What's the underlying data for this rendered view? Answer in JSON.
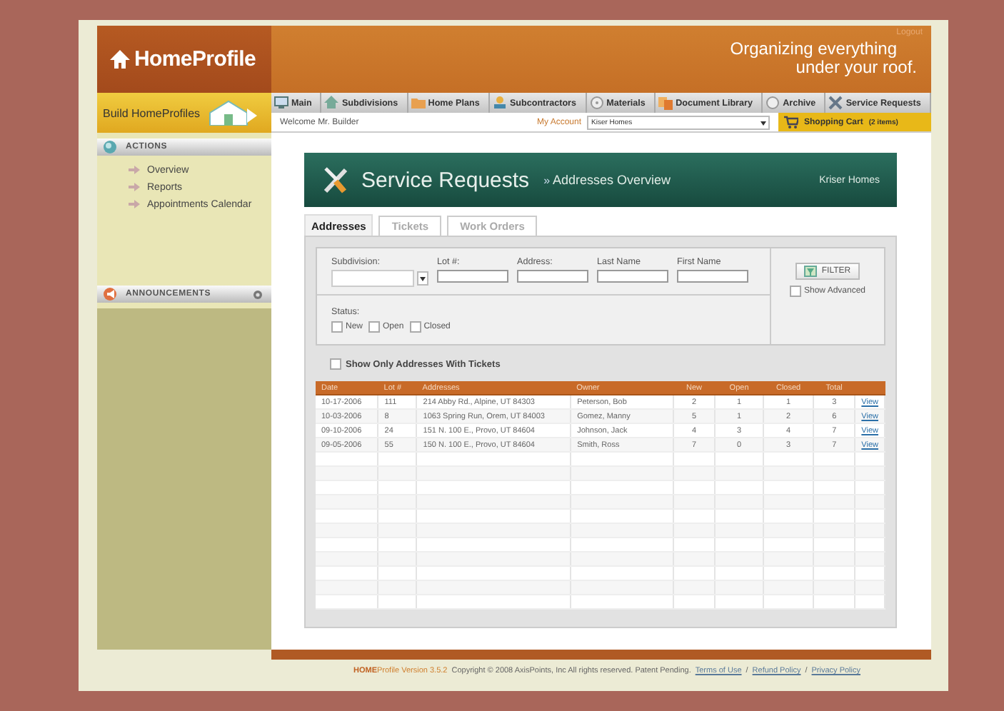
{
  "header": {
    "logo": "HomeProfile",
    "tagline_1": "Organizing everything",
    "tagline_2": "under your roof.",
    "logout": "Logout"
  },
  "build_label": "Build HomeProfiles",
  "nav": {
    "items": [
      {
        "label": "Main"
      },
      {
        "label": "Subdivisions"
      },
      {
        "label": "Home Plans"
      },
      {
        "label": "Subcontractors"
      },
      {
        "label": "Materials"
      },
      {
        "label": "Document Library"
      },
      {
        "label": "Archive"
      },
      {
        "label": "Service Requests"
      }
    ],
    "welcome": "Welcome Mr. Builder",
    "account_link": "My Account",
    "company_select": "Kiser Homes",
    "cart": "Shopping Cart",
    "cart_count": "(2 items)"
  },
  "sidebar": {
    "actions_title": "ACTIONS",
    "actions": [
      "Overview",
      "Reports",
      "Appointments Calendar"
    ],
    "announcements_title": "ANNOUNCEMENTS"
  },
  "page": {
    "title": "Service Requests",
    "separator": "»",
    "subtitle": "Addresses Overview",
    "company": "Kriser Homes"
  },
  "tabs": [
    {
      "label": "Addresses",
      "selected": true
    },
    {
      "label": "Tickets",
      "selected": false
    },
    {
      "label": "Work Orders",
      "selected": false
    }
  ],
  "filter": {
    "fields": [
      {
        "label": "Subdivision:",
        "kind": "select"
      },
      {
        "label": "Lot #:",
        "kind": "text"
      },
      {
        "label": "Address:",
        "kind": "text"
      },
      {
        "label": "Last Name",
        "kind": "text"
      },
      {
        "label": "First Name",
        "kind": "text"
      }
    ],
    "filter_button": "FILTER",
    "show_advanced": {
      "label": "Show Advanced",
      "checked": false
    },
    "status_label": "Status:",
    "statuses": [
      {
        "label": "New",
        "checked": false
      },
      {
        "label": "Open",
        "checked": false
      },
      {
        "label": "Closed",
        "checked": false
      }
    ]
  },
  "only_tickets": {
    "label": "Show Only Addresses With Tickets",
    "checked": false
  },
  "table": {
    "columns": [
      "Date",
      "Lot #",
      "Addresses",
      "Owner",
      "New",
      "Open",
      "Closed",
      "Total"
    ],
    "rows": [
      {
        "cells": [
          "10-17-2006",
          "111",
          "214 Abby Rd., Alpine, UT 84303",
          "Peterson, Bob",
          "2",
          "1",
          "1",
          "3"
        ],
        "action": "View"
      },
      {
        "cells": [
          "10-03-2006",
          "8",
          "1063 Spring Run, Orem, UT 84003",
          "Gomez, Manny",
          "5",
          "1",
          "2",
          "6"
        ],
        "action": "View"
      },
      {
        "cells": [
          "09-10-2006",
          "24",
          "151 N. 100 E., Provo, UT 84604",
          "Johnson, Jack",
          "4",
          "3",
          "4",
          "7"
        ],
        "action": "View"
      },
      {
        "cells": [
          "09-05-2006",
          "55",
          "150 N. 100 E., Provo, UT 84604",
          "Smith, Ross",
          "7",
          "0",
          "3",
          "7"
        ],
        "action": "View"
      }
    ]
  },
  "footer": {
    "version": "**HOME**Profile Version 3.5.2",
    "copyright": "Copyright © 2008 AxisPoints, Inc All rights reserved. Patent Pending.",
    "links": [
      "Terms of Use",
      "Refund Policy",
      "Privacy Policy"
    ],
    "link_separator": "/"
  }
}
